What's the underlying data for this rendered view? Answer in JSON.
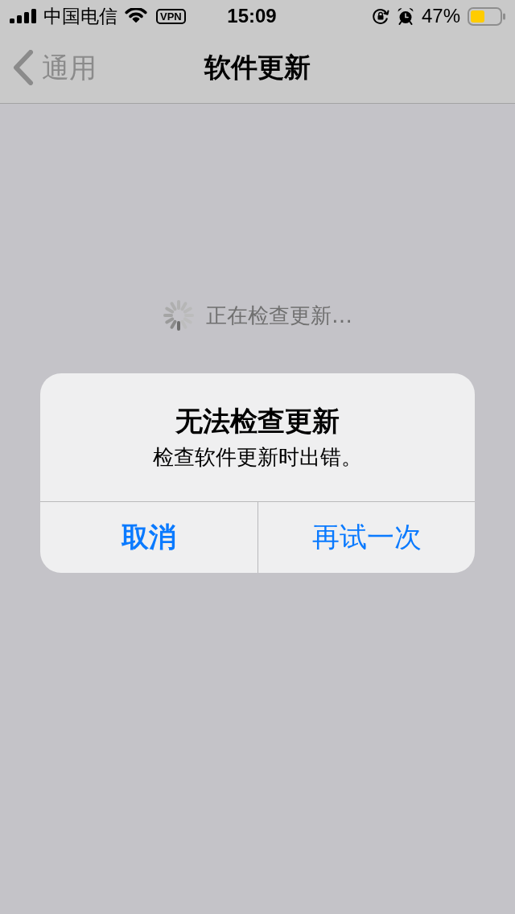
{
  "status_bar": {
    "carrier": "中国电信",
    "vpn": "VPN",
    "time": "15:09",
    "battery_percent": "47%"
  },
  "nav_bar": {
    "back": "通用",
    "title": "软件更新"
  },
  "loading": {
    "text": "正在检查更新…"
  },
  "alert": {
    "title": "无法检查更新",
    "message": "检查软件更新时出错。",
    "buttons": [
      {
        "label": "取消",
        "kind": "cancel"
      },
      {
        "label": "再试一次",
        "kind": "default"
      }
    ]
  }
}
